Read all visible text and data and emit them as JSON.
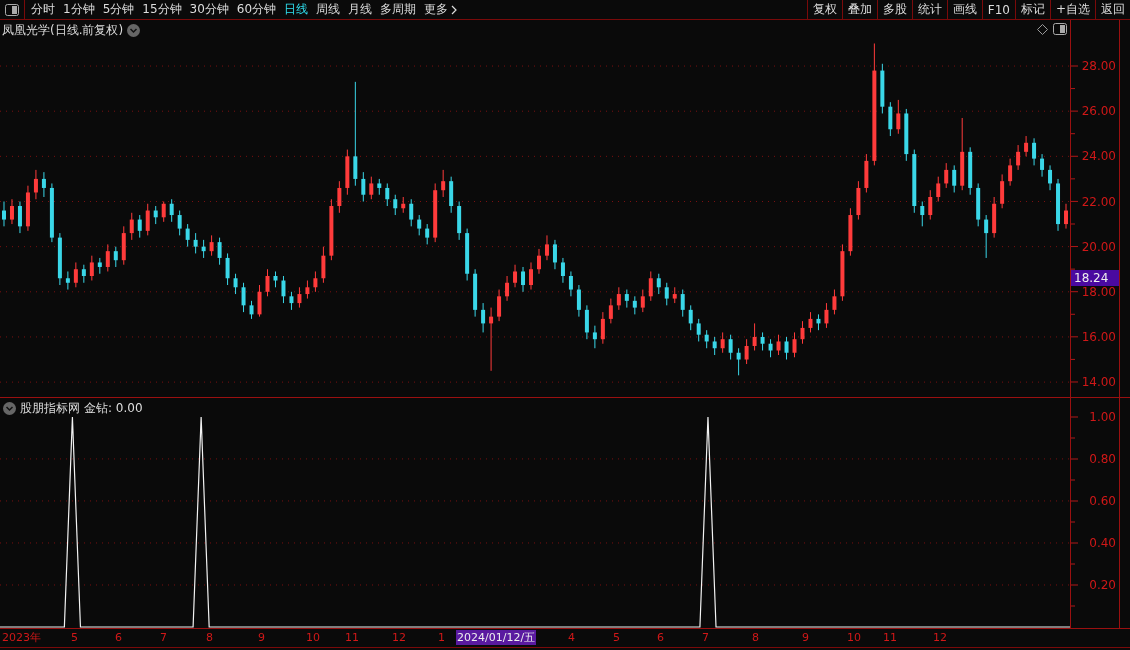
{
  "toolbar": {
    "periods": [
      {
        "label": "分时",
        "selected": false
      },
      {
        "label": "1分钟",
        "selected": false
      },
      {
        "label": "5分钟",
        "selected": false
      },
      {
        "label": "15分钟",
        "selected": false
      },
      {
        "label": "30分钟",
        "selected": false
      },
      {
        "label": "60分钟",
        "selected": false
      },
      {
        "label": "日线",
        "selected": true
      },
      {
        "label": "周线",
        "selected": false
      },
      {
        "label": "月线",
        "selected": false
      },
      {
        "label": "多周期",
        "selected": false
      }
    ],
    "more": "更多",
    "actions": [
      "复权",
      "叠加",
      "多股",
      "统计",
      "画线",
      "F10",
      "标记",
      "+自选",
      "返回"
    ]
  },
  "price_panel": {
    "title": "凤凰光学(日线.前复权)",
    "last_price": "18.24",
    "chart_data": {
      "type": "candlestick",
      "ylim": [
        13.34,
        30.04
      ],
      "grid": true,
      "ohlc": [
        [
          21.6,
          22.0,
          20.9,
          21.2
        ],
        [
          21.2,
          22.1,
          21.0,
          21.8
        ],
        [
          21.8,
          22.0,
          20.6,
          20.9
        ],
        [
          20.9,
          22.7,
          20.7,
          22.4
        ],
        [
          22.4,
          23.4,
          22.1,
          23.0
        ],
        [
          23.0,
          23.3,
          22.2,
          22.6
        ],
        [
          22.6,
          22.8,
          20.2,
          20.4
        ],
        [
          20.4,
          20.6,
          18.3,
          18.6
        ],
        [
          18.6,
          18.9,
          18.1,
          18.4
        ],
        [
          18.4,
          19.3,
          18.2,
          19.0
        ],
        [
          19.0,
          19.2,
          18.4,
          18.7
        ],
        [
          18.7,
          19.6,
          18.5,
          19.3
        ],
        [
          19.3,
          19.5,
          18.8,
          19.1
        ],
        [
          19.1,
          20.1,
          18.9,
          19.8
        ],
        [
          19.8,
          20.0,
          19.1,
          19.4
        ],
        [
          19.4,
          20.9,
          19.2,
          20.6
        ],
        [
          20.6,
          21.5,
          20.3,
          21.2
        ],
        [
          21.2,
          21.4,
          20.4,
          20.7
        ],
        [
          20.7,
          21.9,
          20.5,
          21.6
        ],
        [
          21.6,
          21.8,
          21.0,
          21.3
        ],
        [
          21.3,
          22.0,
          21.1,
          21.9
        ],
        [
          21.9,
          22.1,
          21.1,
          21.4
        ],
        [
          21.4,
          21.6,
          20.5,
          20.8
        ],
        [
          20.8,
          21.0,
          20.0,
          20.3
        ],
        [
          20.3,
          20.6,
          19.7,
          20.0
        ],
        [
          20.0,
          20.3,
          19.5,
          19.8
        ],
        [
          19.8,
          20.5,
          19.6,
          20.2
        ],
        [
          20.2,
          20.4,
          19.2,
          19.5
        ],
        [
          19.5,
          19.7,
          18.3,
          18.6
        ],
        [
          18.6,
          18.8,
          17.9,
          18.2
        ],
        [
          18.2,
          18.4,
          17.1,
          17.4
        ],
        [
          17.4,
          17.6,
          16.8,
          17.0
        ],
        [
          17.0,
          18.3,
          16.9,
          18.0
        ],
        [
          18.0,
          19.0,
          17.8,
          18.7
        ],
        [
          18.7,
          18.9,
          18.2,
          18.5
        ],
        [
          18.5,
          18.7,
          17.5,
          17.8
        ],
        [
          17.8,
          18.0,
          17.2,
          17.5
        ],
        [
          17.5,
          18.2,
          17.3,
          17.9
        ],
        [
          17.9,
          18.5,
          17.7,
          18.2
        ],
        [
          18.2,
          18.9,
          18.0,
          18.6
        ],
        [
          18.6,
          20.0,
          18.4,
          19.6
        ],
        [
          19.6,
          22.1,
          19.4,
          21.8
        ],
        [
          21.8,
          22.9,
          21.5,
          22.6
        ],
        [
          22.6,
          24.3,
          22.3,
          24.0
        ],
        [
          24.0,
          27.3,
          22.7,
          23.0
        ],
        [
          23.0,
          23.3,
          22.0,
          22.3
        ],
        [
          22.3,
          23.1,
          22.1,
          22.8
        ],
        [
          22.8,
          23.0,
          22.3,
          22.6
        ],
        [
          22.6,
          22.8,
          21.8,
          22.1
        ],
        [
          22.1,
          22.3,
          21.4,
          21.7
        ],
        [
          21.7,
          22.2,
          21.5,
          21.9
        ],
        [
          21.9,
          22.1,
          20.9,
          21.2
        ],
        [
          21.2,
          21.4,
          20.5,
          20.8
        ],
        [
          20.8,
          21.0,
          20.1,
          20.4
        ],
        [
          20.4,
          22.8,
          20.2,
          22.5
        ],
        [
          22.5,
          23.4,
          22.2,
          22.9
        ],
        [
          22.9,
          23.1,
          21.5,
          21.8
        ],
        [
          21.8,
          22.0,
          20.3,
          20.6
        ],
        [
          20.6,
          20.8,
          18.5,
          18.8
        ],
        [
          18.8,
          19.0,
          16.9,
          17.2
        ],
        [
          17.2,
          17.5,
          16.2,
          16.6
        ],
        [
          16.6,
          17.3,
          14.5,
          16.9
        ],
        [
          16.9,
          18.1,
          16.7,
          17.8
        ],
        [
          17.8,
          18.7,
          17.6,
          18.4
        ],
        [
          18.4,
          19.2,
          18.2,
          18.9
        ],
        [
          18.9,
          19.1,
          18.0,
          18.3
        ],
        [
          18.3,
          19.3,
          18.1,
          19.0
        ],
        [
          19.0,
          19.9,
          18.8,
          19.6
        ],
        [
          19.6,
          20.5,
          19.4,
          20.1
        ],
        [
          20.1,
          20.3,
          19.0,
          19.3
        ],
        [
          19.3,
          19.5,
          18.4,
          18.7
        ],
        [
          18.7,
          18.9,
          17.8,
          18.1
        ],
        [
          18.1,
          18.3,
          16.9,
          17.2
        ],
        [
          17.2,
          17.4,
          15.9,
          16.2
        ],
        [
          16.2,
          16.5,
          15.5,
          15.9
        ],
        [
          15.9,
          17.1,
          15.7,
          16.8
        ],
        [
          16.8,
          17.7,
          16.6,
          17.4
        ],
        [
          17.4,
          18.2,
          17.2,
          17.9
        ],
        [
          17.9,
          18.1,
          17.3,
          17.6
        ],
        [
          17.6,
          17.8,
          17.0,
          17.3
        ],
        [
          17.3,
          18.1,
          17.1,
          17.8
        ],
        [
          17.8,
          18.9,
          17.6,
          18.6
        ],
        [
          18.6,
          18.8,
          17.9,
          18.2
        ],
        [
          18.2,
          18.4,
          17.4,
          17.7
        ],
        [
          17.7,
          18.2,
          17.5,
          17.9
        ],
        [
          17.9,
          18.1,
          16.9,
          17.2
        ],
        [
          17.2,
          17.4,
          16.3,
          16.6
        ],
        [
          16.6,
          16.8,
          15.8,
          16.1
        ],
        [
          16.1,
          16.3,
          15.5,
          15.8
        ],
        [
          15.8,
          16.0,
          15.2,
          15.5
        ],
        [
          15.5,
          16.2,
          15.3,
          15.9
        ],
        [
          15.9,
          16.1,
          15.0,
          15.3
        ],
        [
          15.3,
          15.5,
          14.3,
          15.0
        ],
        [
          15.0,
          15.9,
          14.8,
          15.6
        ],
        [
          15.6,
          16.6,
          15.4,
          16.0
        ],
        [
          16.0,
          16.2,
          15.4,
          15.7
        ],
        [
          15.7,
          15.9,
          15.1,
          15.4
        ],
        [
          15.4,
          16.1,
          15.2,
          15.8
        ],
        [
          15.8,
          16.0,
          15.0,
          15.3
        ],
        [
          15.3,
          16.2,
          15.1,
          15.9
        ],
        [
          15.9,
          16.7,
          15.7,
          16.4
        ],
        [
          16.4,
          17.1,
          16.2,
          16.8
        ],
        [
          16.8,
          17.0,
          16.3,
          16.6
        ],
        [
          16.6,
          17.5,
          16.4,
          17.2
        ],
        [
          17.2,
          18.1,
          17.0,
          17.8
        ],
        [
          17.8,
          20.1,
          17.6,
          19.8
        ],
        [
          19.8,
          21.7,
          19.6,
          21.4
        ],
        [
          21.4,
          22.9,
          21.2,
          22.6
        ],
        [
          22.6,
          24.1,
          22.4,
          23.8
        ],
        [
          23.8,
          29.0,
          23.6,
          27.8
        ],
        [
          27.8,
          28.1,
          25.9,
          26.2
        ],
        [
          26.2,
          26.4,
          24.9,
          25.2
        ],
        [
          25.2,
          26.5,
          25.0,
          25.9
        ],
        [
          25.9,
          26.1,
          23.8,
          24.1
        ],
        [
          24.1,
          24.3,
          21.5,
          21.8
        ],
        [
          21.8,
          22.0,
          20.9,
          21.4
        ],
        [
          21.4,
          22.5,
          21.2,
          22.2
        ],
        [
          22.2,
          23.1,
          22.0,
          22.8
        ],
        [
          22.8,
          23.7,
          22.6,
          23.4
        ],
        [
          23.4,
          23.6,
          22.4,
          22.7
        ],
        [
          22.7,
          25.7,
          22.5,
          24.2
        ],
        [
          24.2,
          24.4,
          22.3,
          22.6
        ],
        [
          22.6,
          22.8,
          20.9,
          21.2
        ],
        [
          21.2,
          21.4,
          19.5,
          20.6
        ],
        [
          20.6,
          22.2,
          20.4,
          21.9
        ],
        [
          21.9,
          23.2,
          21.7,
          22.9
        ],
        [
          22.9,
          23.9,
          22.7,
          23.6
        ],
        [
          23.6,
          24.5,
          23.4,
          24.2
        ],
        [
          24.2,
          24.9,
          24.0,
          24.6
        ],
        [
          24.6,
          24.8,
          23.6,
          23.9
        ],
        [
          23.9,
          24.1,
          23.1,
          23.4
        ],
        [
          23.4,
          23.6,
          22.5,
          22.8
        ],
        [
          22.8,
          23.0,
          20.7,
          21.0
        ],
        [
          21.0,
          21.9,
          20.8,
          21.6
        ]
      ],
      "yticks": [
        {
          "value": 28,
          "label": "28.00"
        },
        {
          "value": 26,
          "label": "26.00"
        },
        {
          "value": 24,
          "label": "24.00"
        },
        {
          "value": 22,
          "label": "22.00"
        },
        {
          "value": 20,
          "label": "20.00"
        },
        {
          "value": 18,
          "label": "18.00"
        },
        {
          "value": 16,
          "label": "16.00"
        },
        {
          "value": 14,
          "label": "14.00"
        }
      ]
    }
  },
  "indicator_panel": {
    "title": "股朋指标网",
    "reading": "金钻: 0.00",
    "chart_data": {
      "type": "line",
      "ylim": [
        0,
        1.09
      ],
      "grid": true,
      "values": [
        0,
        0,
        0,
        0,
        0,
        0,
        0,
        0,
        0,
        1,
        0,
        0,
        0,
        0,
        0,
        0,
        0,
        0,
        0,
        0,
        0,
        0,
        0,
        0,
        0,
        1,
        0,
        0,
        0,
        0,
        0,
        0,
        0,
        0,
        0,
        0,
        0,
        0,
        0,
        0,
        0,
        0,
        0,
        0,
        0,
        0,
        0,
        0,
        0,
        0,
        0,
        0,
        0,
        0,
        0,
        0,
        0,
        0,
        0,
        0,
        0,
        0,
        0,
        0,
        0,
        0,
        0,
        0,
        0,
        0,
        0,
        0,
        0,
        0,
        0,
        0,
        0,
        0,
        0,
        0,
        0,
        0,
        0,
        0,
        0,
        0,
        0,
        0,
        1,
        0,
        0,
        0,
        0,
        0,
        0,
        0,
        0,
        0,
        0,
        0,
        0,
        0,
        0,
        0,
        0,
        0,
        0,
        0,
        0,
        0,
        0,
        0,
        0,
        0,
        0,
        0,
        0,
        0,
        0,
        0,
        0,
        0,
        0,
        0,
        0,
        0,
        0,
        0,
        0,
        0,
        0,
        0,
        0,
        0
      ],
      "yticks": [
        {
          "value": 1,
          "label": "1.00"
        },
        {
          "value": 0.8,
          "label": "0.80"
        },
        {
          "value": 0.6,
          "label": "0.60"
        },
        {
          "value": 0.4,
          "label": "0.40"
        },
        {
          "value": 0.2,
          "label": "0.20"
        }
      ]
    }
  },
  "time_axis": {
    "labels": [
      "2023年",
      "5",
      "6",
      "7",
      "8",
      "9",
      "10",
      "11",
      "12",
      "1",
      "4",
      "5",
      "6",
      "7",
      "8",
      "9",
      "10",
      "11",
      "12"
    ],
    "cursor_date": "2024/01/12/五"
  }
}
